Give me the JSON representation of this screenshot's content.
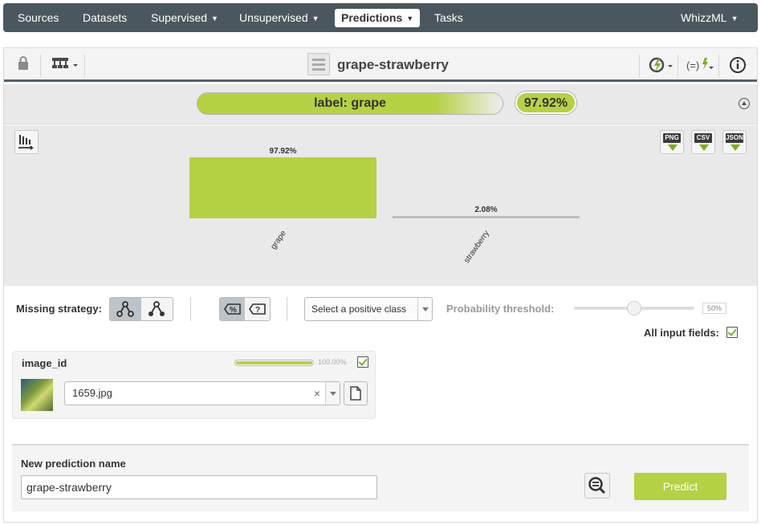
{
  "nav": {
    "items": [
      {
        "label": "Sources",
        "dropdown": false
      },
      {
        "label": "Datasets",
        "dropdown": false
      },
      {
        "label": "Supervised",
        "dropdown": true
      },
      {
        "label": "Unsupervised",
        "dropdown": true
      },
      {
        "label": "Predictions",
        "dropdown": true,
        "active": true
      },
      {
        "label": "Tasks",
        "dropdown": false
      }
    ],
    "user": "WhizzML"
  },
  "toolbar": {
    "title": "grape-strawberry",
    "icons": [
      "lock-icon",
      "model-tree-icon",
      "title-resource-icon",
      "lightning-cycle-icon",
      "formula-lightning-icon",
      "info-icon"
    ]
  },
  "prediction": {
    "label_text": "label: grape",
    "confidence": "97.92%",
    "confidence_fraction": 0.9792
  },
  "chart_data": {
    "type": "bar",
    "categories": [
      "grape",
      "strawberry"
    ],
    "values": [
      97.92,
      2.08
    ],
    "data_labels": [
      "97.92%",
      "2.08%"
    ],
    "ylim": [
      0,
      100
    ],
    "xlabel": "",
    "ylabel": "",
    "title": "",
    "grid": false,
    "colors": [
      "#b5d144",
      "#bdbdbd"
    ]
  },
  "export": {
    "png": "PNG",
    "csv": "CSV",
    "json": "JSON"
  },
  "options": {
    "missing_strategy_label": "Missing strategy:",
    "positive_class_placeholder": "Select a positive class",
    "threshold_label": "Probability threshold:",
    "threshold_value": "50%",
    "threshold_fraction": 0.5,
    "all_input_fields_label": "All input fields:"
  },
  "field": {
    "name": "image_id",
    "progress_text": "100.00%",
    "progress_fraction": 1.0,
    "value": "1659.jpg",
    "clear": "×"
  },
  "bottom": {
    "name_label": "New prediction name",
    "name_value": "grape-strawberry",
    "predict_label": "Predict"
  },
  "colors": {
    "nav_bg": "#4b575f",
    "accent": "#b5d144",
    "check": "#7cae1e"
  }
}
